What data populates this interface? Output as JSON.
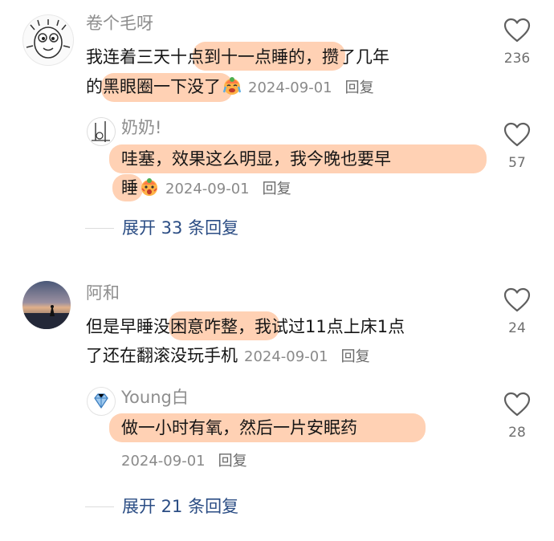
{
  "comments": [
    {
      "username": "卷个毛呀",
      "avatar_icon": "doodle-face-avatar",
      "lines": [
        "我连着三天十点到十一点睡的，攒了几年",
        "的黑眼圈一下没了"
      ],
      "emoji": "crying-laughing-face-icon",
      "date": "2024-09-01",
      "reply_label": "回复",
      "likes": "236",
      "replies": [
        {
          "username": "奶奶!",
          "avatar_icon": "sketch-avatar",
          "lines": [
            "哇塞，效果这么明显，我今晚也要早",
            "睡"
          ],
          "emoji": "shocked-face-icon",
          "date": "2024-09-01",
          "reply_label": "回复",
          "likes": "57"
        }
      ],
      "expand_label": "展开 33 条回复"
    },
    {
      "username": "阿和",
      "avatar_icon": "sunset-avatar",
      "lines": [
        "但是早睡没困意咋整，我试过11点上床1点",
        "了还在翻滚没玩手机"
      ],
      "date": "2024-09-01",
      "reply_label": "回复",
      "likes": "24",
      "replies": [
        {
          "username": "Young白",
          "avatar_icon": "diamond-avatar",
          "lines": [
            "做一小时有氧，然后一片安眠药"
          ],
          "date": "2024-09-01",
          "reply_label": "回复",
          "likes": "28"
        }
      ],
      "expand_label": "展开 21 条回复"
    }
  ],
  "colors": {
    "highlight": "#ffd1b4",
    "expand_link": "#2b4d84",
    "username": "#8e8e8e"
  }
}
